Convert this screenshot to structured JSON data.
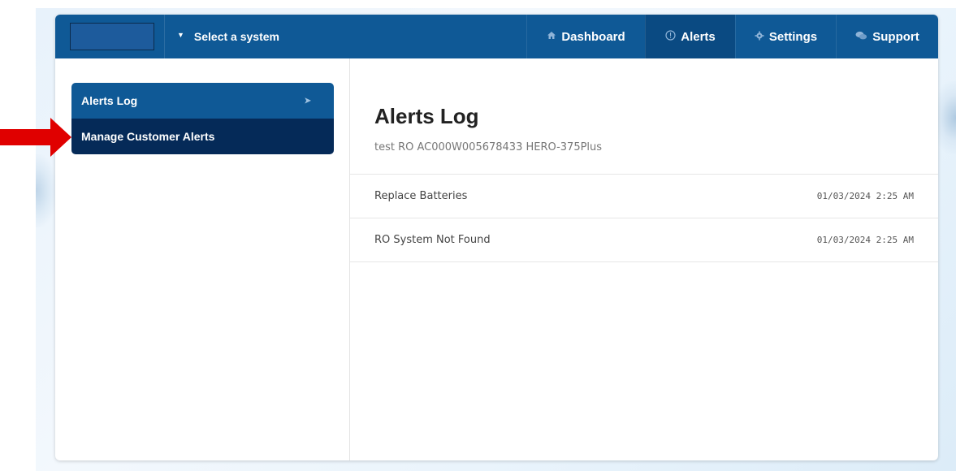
{
  "header": {
    "system_select_label": "Select a system",
    "nav": [
      {
        "label": "Dashboard",
        "icon": "home-icon"
      },
      {
        "label": "Alerts",
        "icon": "alert-circle-icon",
        "active": true
      },
      {
        "label": "Settings",
        "icon": "gear-icon"
      },
      {
        "label": "Support",
        "icon": "chat-bubbles-icon"
      }
    ]
  },
  "sidebar": {
    "items": [
      {
        "label": "Alerts Log",
        "active": true
      },
      {
        "label": "Manage Customer Alerts"
      }
    ]
  },
  "main": {
    "title": "Alerts Log",
    "subtitle": "test RO AC000W005678433 HERO-375Plus",
    "alerts": [
      {
        "name": "Replace Batteries",
        "time": "01/03/2024 2:25 AM"
      },
      {
        "name": "RO System Not Found",
        "time": "01/03/2024 2:25 AM"
      }
    ]
  },
  "colors": {
    "nav_bg": "#0f5996",
    "nav_active": "#0a4a82",
    "sidebar_active": "#052a58",
    "annotation_arrow": "#e00000"
  }
}
